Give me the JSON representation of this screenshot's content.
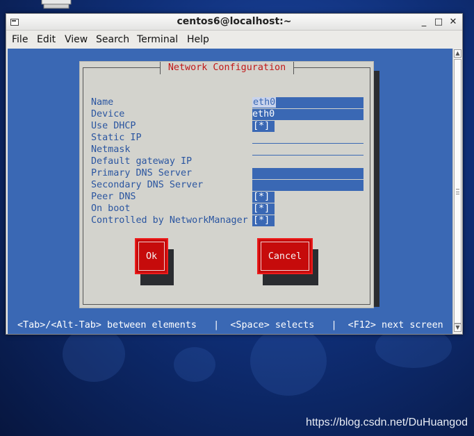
{
  "window": {
    "title": "centos6@localhost:~",
    "minimize_glyph": "_",
    "maximize_glyph": "□",
    "close_glyph": "✕"
  },
  "menubar": [
    "File",
    "Edit",
    "View",
    "Search",
    "Terminal",
    "Help"
  ],
  "dialog": {
    "title": "Network Configuration",
    "fields": [
      {
        "label": "Name",
        "value": "eth0",
        "kind": "text"
      },
      {
        "label": "Device",
        "value": "eth0",
        "kind": "text"
      },
      {
        "label": "Use DHCP",
        "value": "[*]",
        "kind": "checkbox"
      },
      {
        "label": "Static IP",
        "value": "",
        "kind": "underline"
      },
      {
        "label": "Netmask",
        "value": "",
        "kind": "underline"
      },
      {
        "label": "Default gateway IP",
        "value": "",
        "kind": "none"
      },
      {
        "label": "Primary DNS Server",
        "value": "",
        "kind": "text"
      },
      {
        "label": "Secondary DNS Server",
        "value": "",
        "kind": "text"
      },
      {
        "label": "Peer DNS",
        "value": "[*]",
        "kind": "checkbox"
      },
      {
        "label": "On boot",
        "value": "[*]",
        "kind": "checkbox"
      },
      {
        "label": "Controlled by NetworkManager",
        "value": "[*]",
        "kind": "checkbox"
      }
    ],
    "ok_label": "Ok",
    "cancel_label": "Cancel"
  },
  "status_line": "<Tab>/<Alt-Tab> between elements   |  <Space> selects   |  <F12> next screen",
  "watermark": "https://blog.csdn.net/DuHuangod",
  "colors": {
    "terminal_bg": "#3a68b4",
    "dialog_bg": "#d3d3cd",
    "dialog_title": "#c01818",
    "button_bg": "#c60b0b"
  }
}
